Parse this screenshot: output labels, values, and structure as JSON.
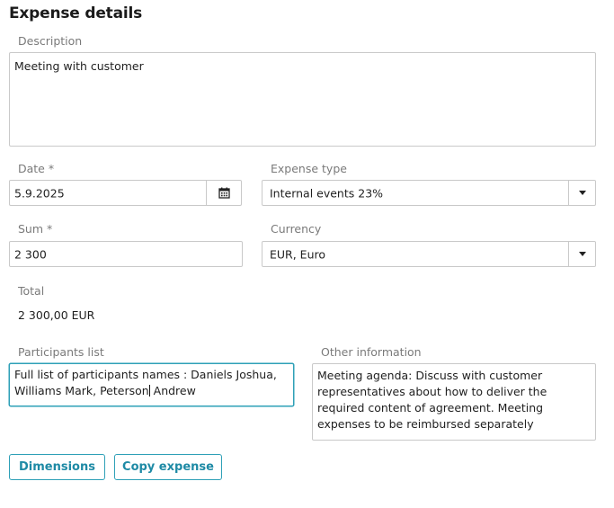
{
  "form": {
    "title": "Expense details",
    "description": {
      "label": "Description",
      "value": "Meeting with customer"
    },
    "date": {
      "label": "Date *",
      "value": "5.9.2025"
    },
    "expense_type": {
      "label": "Expense type",
      "value": "Internal events 23%"
    },
    "sum": {
      "label": "Sum *",
      "value": "2 300"
    },
    "currency": {
      "label": "Currency",
      "value": "EUR, Euro"
    },
    "total": {
      "label": "Total",
      "value": "2 300,00 EUR"
    },
    "participants": {
      "label": "Participants list",
      "value_before_cursor": "Full list of participants names :  Daniels Joshua, Williams Mark, Peterson",
      "value_after_cursor": " Andrew"
    },
    "other_information": {
      "label": "Other information",
      "value": "Meeting agenda: Discuss with customer representatives about how to deliver the required content of agreement. Meeting expenses to be reimbursed separately"
    }
  },
  "actions": {
    "dimensions_label": "Dimensions",
    "copy_expense_label": "Copy expense"
  },
  "icons": {
    "date_picker": "calendar-icon",
    "dropdown": "chevron-down-icon"
  },
  "colors": {
    "accent": "#2ea0b7",
    "button_text": "#1e8aa5",
    "label": "#7a7a7a",
    "border": "#c9c9c9"
  }
}
